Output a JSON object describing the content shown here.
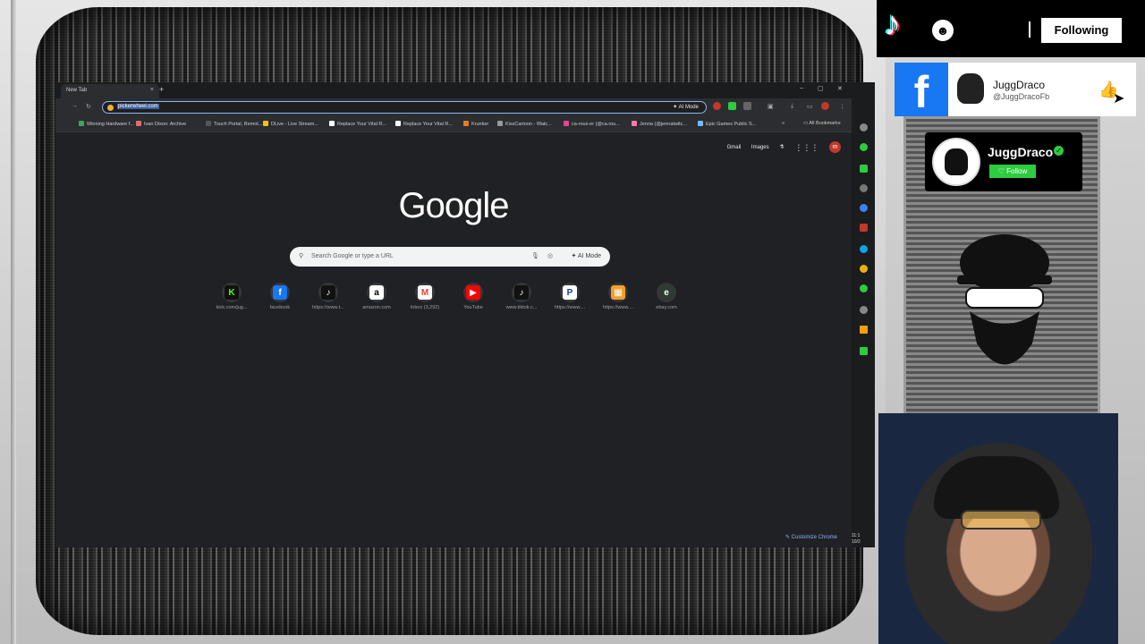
{
  "browser": {
    "tab_title": "New Tab",
    "tab_close": "×",
    "new_tab": "+",
    "win_min": "–",
    "win_max": "▢",
    "win_close": "✕",
    "url": "pickerwheel.com",
    "ai_mode": "AI Mode",
    "bookmarks": [
      {
        "label": "Winning Hardware f...",
        "color": "#3ba55c"
      },
      {
        "label": "Ivan Dixon: Archive",
        "color": "#e06c75"
      },
      {
        "label": "Touch Portal, Remot...",
        "color": "#555555"
      },
      {
        "label": "DLive - Live Stream...",
        "color": "#f1c40f"
      },
      {
        "label": "Replace Your Vital R...",
        "color": "#ffffff"
      },
      {
        "label": "Replace Your Vital R...",
        "color": "#ffffff"
      },
      {
        "label": "Krunker",
        "color": "#e67e22"
      },
      {
        "label": "KissCartoon - Watc...",
        "color": "#999999"
      },
      {
        "label": "ca-rous-er (@ca.rou...",
        "color": "#e84393"
      },
      {
        "label": "Jenna (@jennatwitc...",
        "color": "#fd79a8"
      },
      {
        "label": "Epic Games Public S...",
        "color": "#74b9ff"
      }
    ],
    "bookmarks_more": "»",
    "all_bookmarks": "All Bookmarks",
    "top_links": {
      "gmail": "Gmail",
      "images": "Images",
      "lab": "⚗",
      "apps": "⋮⋮⋮",
      "avatar": "m"
    },
    "logo": "Google",
    "search_placeholder": "Search Google or type a URL",
    "search_ai": "AI Mode",
    "shortcuts": [
      {
        "label": "kick.com/jug...",
        "glyph": "K",
        "color": "#53fc18",
        "bg": "#111111"
      },
      {
        "label": "facebook",
        "glyph": "f",
        "color": "#ffffff",
        "bg": "#1877f2"
      },
      {
        "label": "https://www.t...",
        "glyph": "♪",
        "color": "#ffffff",
        "bg": "#111111"
      },
      {
        "label": "amazon.com",
        "glyph": "a",
        "color": "#000000",
        "bg": "#ffffff"
      },
      {
        "label": "Inbox (3,292)",
        "glyph": "M",
        "color": "#ea4335",
        "bg": "#ffffff"
      },
      {
        "label": "YouTube",
        "glyph": "▶",
        "color": "#ffffff",
        "bg": "#ff0000"
      },
      {
        "label": "www.tiktok.c...",
        "glyph": "♪",
        "color": "#ffffff",
        "bg": "#111111"
      },
      {
        "label": "https://www....",
        "glyph": "P",
        "color": "#1a3c8e",
        "bg": "#ffffff"
      },
      {
        "label": "https://www....",
        "glyph": "▦",
        "color": "#ffffff",
        "bg": "#f0a030"
      },
      {
        "label": "ebay.com",
        "glyph": "e",
        "color": "#ffffff",
        "bg": "#2d3b33"
      }
    ],
    "customize": "✎ Customize Chrome",
    "clock": "11:1\n10/2"
  },
  "overlay": {
    "tiktok_logo": "♪",
    "following": "Following",
    "fb_logo": "f",
    "fb_name": "JuggDraco",
    "fb_handle": "@JuggDracoFb",
    "fb_like": "👍",
    "follow_name": "JuggDraco",
    "follow_verified": "✓",
    "follow_button": "♡ Follow"
  }
}
